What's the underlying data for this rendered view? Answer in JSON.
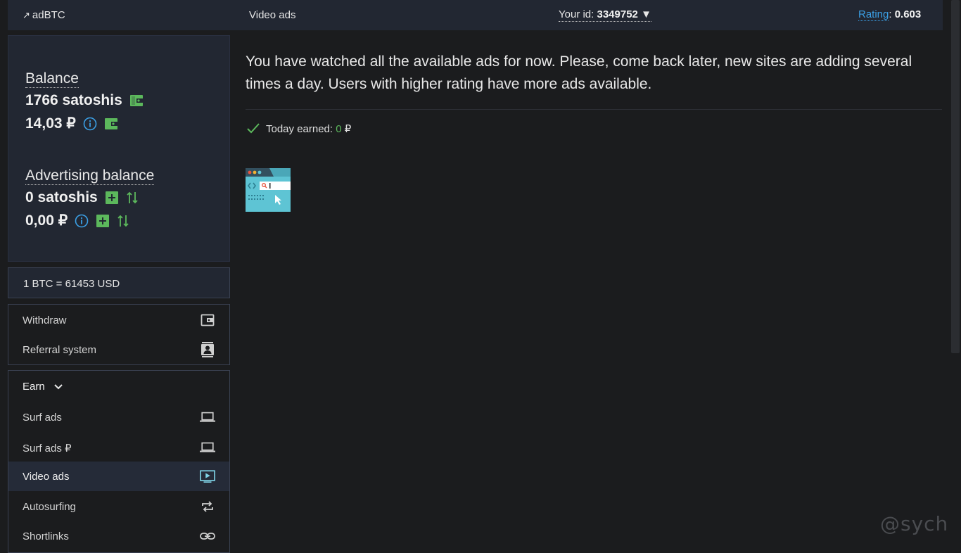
{
  "topbar": {
    "logo_arrow": "↗",
    "logo": "adBTC",
    "section": "Video ads",
    "user_id_label": "Your id:",
    "user_id": "3349752",
    "user_id_caret": "▼",
    "rating_label": "Rating",
    "rating_sep": ":",
    "rating_value": "0.603"
  },
  "balance": {
    "title": "Balance",
    "satoshis": "1766 satoshis",
    "rub": "14,03 ₽",
    "adv_title": "Advertising balance",
    "adv_satoshis": "0 satoshis",
    "adv_rub": "0,00 ₽"
  },
  "btc_rate": "1 BTC = 61453 USD",
  "menu_account": [
    {
      "label": "Withdraw",
      "icon": "wallet-icon"
    },
    {
      "label": "Referral system",
      "icon": "contact-card-icon"
    }
  ],
  "earn": {
    "header": "Earn",
    "items": [
      {
        "label": "Surf ads",
        "icon": "laptop-icon"
      },
      {
        "label": "Surf ads ₽",
        "icon": "laptop-icon"
      },
      {
        "label": "Video ads",
        "icon": "video-play-icon",
        "active": true
      },
      {
        "label": "Autosurfing",
        "icon": "repeat-icon"
      },
      {
        "label": "Shortlinks",
        "icon": "link-icon"
      }
    ]
  },
  "main": {
    "message": "You have watched all the available ads for now. Please, come back later, new sites are adding several times a day. Users with higher rating have more ads available.",
    "today_label": "Today earned:",
    "today_value": "0",
    "today_currency": "₽"
  },
  "watermark": "@sych",
  "colors": {
    "background": "#1b1c1e",
    "panel": "#222732",
    "accent_green": "#5cb85c",
    "link_blue": "#3ba0e6"
  }
}
